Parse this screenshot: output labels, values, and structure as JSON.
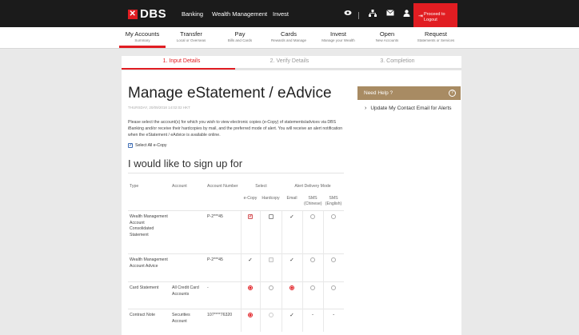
{
  "brand": {
    "name": "DBS"
  },
  "topnav": {
    "links": [
      "Banking",
      "Wealth Management",
      "Invest"
    ],
    "icons": [
      "eye-icon",
      "network-icon",
      "mail-icon",
      "user-icon"
    ],
    "logout": {
      "line1": "Proceed to",
      "line2": "Logout"
    }
  },
  "subnav": [
    {
      "title": "My Accounts",
      "subtitle": "Summary"
    },
    {
      "title": "Transfer",
      "subtitle": "Local or Overseas"
    },
    {
      "title": "Pay",
      "subtitle": "Bills and Cards"
    },
    {
      "title": "Cards",
      "subtitle": "Rewards and Manage"
    },
    {
      "title": "Invest",
      "subtitle": "Manage your Wealth"
    },
    {
      "title": "Open",
      "subtitle": "New Accounts"
    },
    {
      "title": "Request",
      "subtitle": "Statements or Services"
    }
  ],
  "steps": [
    "1. Input Details",
    "2. Verify Details",
    "3. Completion"
  ],
  "page": {
    "title": "Manage eStatement / eAdvice",
    "date": "THURSDAY, 20/09/2018 14:02:02 HKT",
    "intro": "Please select the account(s) for which you wish to view electronic copies (e-Copy) of statements/advices via DBS iBanking and/or receive their hardcopies by mail, and the preferred mode of alert. You will receive an alert notification when the eStatement / eAdvice is available online.",
    "select_all": "Select All e-Copy",
    "subtitle": "I would like to sign up for"
  },
  "table": {
    "headers": {
      "type": "Type",
      "account": "Account",
      "account_number": "Account Number",
      "select": "Select",
      "alert_mode": "Alert Delivery Mode",
      "ecopy": "e-Copy",
      "hardcopy": "Hardcopy",
      "email": "Email",
      "sms_cn": "SMS (Chinese)",
      "sms_en": "SMS (English)"
    },
    "rows": [
      {
        "type": "Wealth Management Account Consolidated Statement",
        "account": "",
        "number": "P-2***45"
      },
      {
        "type": "Wealth Management Account Advice",
        "account": "",
        "number": "P-2***45"
      },
      {
        "type": "Card Statement",
        "account": "All Credit Card Accounts",
        "number": "-"
      },
      {
        "type": "Contract Note",
        "account": "Securities Account",
        "number": "107****76320"
      }
    ],
    "dash": "-"
  },
  "help": {
    "title": "Need Help ?",
    "q": "?",
    "link": "Update My Contact Email for Alerts"
  },
  "colors": {
    "brand_red": "#e11d22",
    "help_gold": "#a88b63",
    "bar_dark": "#1b1b1b"
  }
}
